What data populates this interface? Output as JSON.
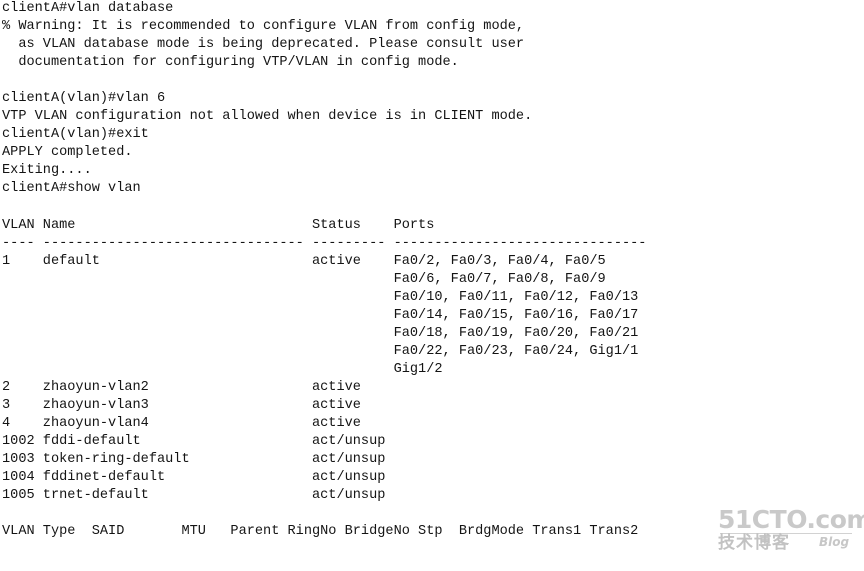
{
  "terminal": {
    "background_color": "#ffffff",
    "text_color": "#141414",
    "hostname": "clientA",
    "prompt_exec": "clientA#",
    "prompt_vlan": "clientA(vlan)#",
    "lines": [
      "clientA#vlan database",
      "% Warning: It is recommended to configure VLAN from config mode,",
      "  as VLAN database mode is being deprecated. Please consult user",
      "  documentation for configuring VTP/VLAN in config mode.",
      "",
      "clientA(vlan)#vlan 6",
      "VTP VLAN configuration not allowed when device is in CLIENT mode.",
      "clientA(vlan)#exit",
      "APPLY completed.",
      "Exiting....",
      "clientA#show vlan",
      "",
      "VLAN Name                             Status    Ports",
      "---- -------------------------------- --------- -------------------------------",
      "1    default                          active    Fa0/2, Fa0/3, Fa0/4, Fa0/5",
      "                                                Fa0/6, Fa0/7, Fa0/8, Fa0/9",
      "                                                Fa0/10, Fa0/11, Fa0/12, Fa0/13",
      "                                                Fa0/14, Fa0/15, Fa0/16, Fa0/17",
      "                                                Fa0/18, Fa0/19, Fa0/20, Fa0/21",
      "                                                Fa0/22, Fa0/23, Fa0/24, Gig1/1",
      "                                                Gig1/2",
      "2    zhaoyun-vlan2                    active",
      "3    zhaoyun-vlan3                    active",
      "4    zhaoyun-vlan4                    active",
      "1002 fddi-default                     act/unsup",
      "1003 token-ring-default               act/unsup",
      "1004 fddinet-default                  act/unsup",
      "1005 trnet-default                    act/unsup",
      "",
      "VLAN Type  SAID       MTU   Parent RingNo BridgeNo Stp  BrdgMode Trans1 Trans2"
    ],
    "commands": [
      "vlan database",
      "vlan 6",
      "exit",
      "show vlan"
    ],
    "messages": [
      "% Warning: It is recommended to configure VLAN from config mode, as VLAN database mode is being deprecated. Please consult user documentation for configuring VTP/VLAN in config mode.",
      "VTP VLAN configuration not allowed when device is in CLIENT mode.",
      "APPLY completed.",
      "Exiting...."
    ],
    "vlan_table": {
      "headers": [
        "VLAN",
        "Name",
        "Status",
        "Ports"
      ],
      "separator": "---- -------------------------------- --------- -------------------------------",
      "rows": [
        {
          "vlan": "1",
          "name": "default",
          "status": "active",
          "ports": [
            "Fa0/2, Fa0/3, Fa0/4, Fa0/5",
            "Fa0/6, Fa0/7, Fa0/8, Fa0/9",
            "Fa0/10, Fa0/11, Fa0/12, Fa0/13",
            "Fa0/14, Fa0/15, Fa0/16, Fa0/17",
            "Fa0/18, Fa0/19, Fa0/20, Fa0/21",
            "Fa0/22, Fa0/23, Fa0/24, Gig1/1",
            "Gig1/2"
          ]
        },
        {
          "vlan": "2",
          "name": "zhaoyun-vlan2",
          "status": "active",
          "ports": []
        },
        {
          "vlan": "3",
          "name": "zhaoyun-vlan3",
          "status": "active",
          "ports": []
        },
        {
          "vlan": "4",
          "name": "zhaoyun-vlan4",
          "status": "active",
          "ports": []
        },
        {
          "vlan": "1002",
          "name": "fddi-default",
          "status": "act/unsup",
          "ports": []
        },
        {
          "vlan": "1003",
          "name": "token-ring-default",
          "status": "act/unsup",
          "ports": []
        },
        {
          "vlan": "1004",
          "name": "fddinet-default",
          "status": "act/unsup",
          "ports": []
        },
        {
          "vlan": "1005",
          "name": "trnet-default",
          "status": "act/unsup",
          "ports": []
        }
      ]
    },
    "vlan_detail_headers": [
      "VLAN",
      "Type",
      "SAID",
      "MTU",
      "Parent",
      "RingNo",
      "BridgeNo",
      "Stp",
      "BrdgMode",
      "Trans1",
      "Trans2"
    ],
    "vlan_detail_header_line": "VLAN Type  SAID       MTU   Parent RingNo BridgeNo Stp  BrdgMode Trans1 Trans2"
  },
  "watermark": {
    "main": "51CTO.com",
    "cn": "技术博客",
    "blog": "Blog",
    "color": "#c9c9c9"
  }
}
